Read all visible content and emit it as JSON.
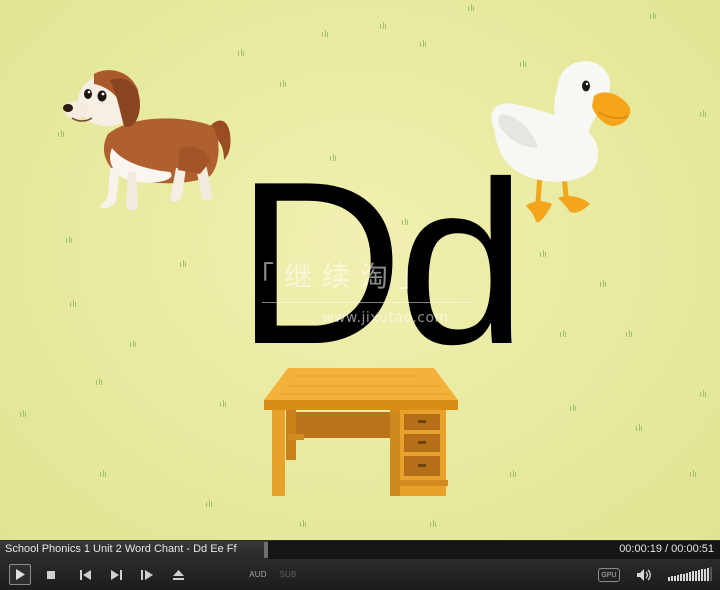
{
  "video": {
    "letters": "Dd",
    "watermark": {
      "cn": "「继续淘」",
      "url": "www.jixutao.com"
    },
    "background_color": "#e9eba2"
  },
  "player": {
    "title": "School Phonics 1 Unit 2 Word Chant - Dd Ee Ff",
    "current_time": "00:00:19",
    "total_time": "00:00:51",
    "time_display": "00:00:19 / 00:00:51",
    "progress": 0.37,
    "volume_level": 0.9,
    "buttons": {
      "play": "play-icon",
      "stop": "stop-icon",
      "prev": "skip-back-icon",
      "next": "skip-forward-icon",
      "frame_step": "frame-step-icon",
      "eject": "eject-icon",
      "audio_label": "AUD",
      "subtitle_label": "SUB",
      "gpu_label": "GPU",
      "volume": "speaker-icon"
    }
  }
}
